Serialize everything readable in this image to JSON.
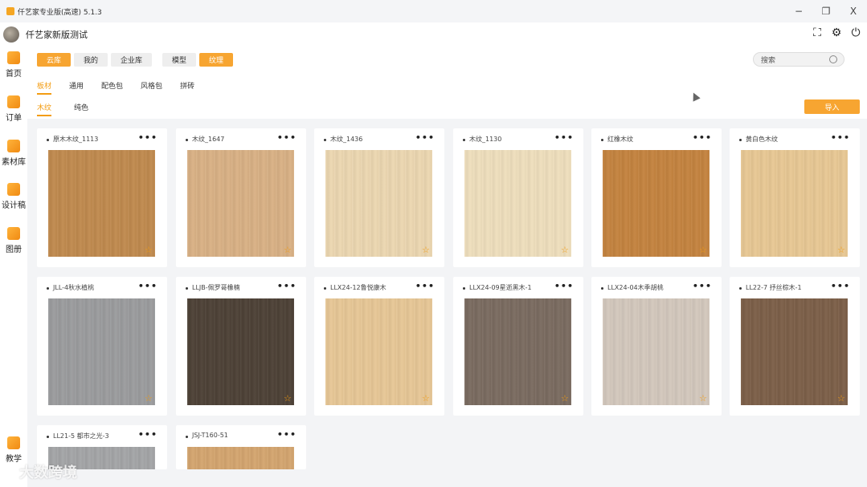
{
  "window": {
    "title": "仟艺家专业版(高速) 5.1.3",
    "min": "−",
    "max": "❐",
    "close": "X"
  },
  "header": {
    "user": "仟艺家新版测试"
  },
  "sidebar": [
    {
      "label": "首页",
      "icon": "home-icon"
    },
    {
      "label": "订单",
      "icon": "order-icon"
    },
    {
      "label": "素材库",
      "icon": "material-icon"
    },
    {
      "label": "设计稿",
      "icon": "design-icon"
    },
    {
      "label": "图册",
      "icon": "album-icon"
    },
    {
      "label": "教学",
      "icon": "teach-icon"
    }
  ],
  "tabs": {
    "cloud": "云库",
    "mine": "我的",
    "enterprise": "企业库",
    "model": "模型",
    "texture": "纹理"
  },
  "search": {
    "placeholder": "搜索"
  },
  "categories": [
    "板材",
    "通用",
    "配色包",
    "风格包",
    "拼砖"
  ],
  "subcategories": [
    "木纹",
    "纯色"
  ],
  "import_label": "导入",
  "materials": [
    {
      "name": "原木木纹_1113",
      "color": "#c08a4e"
    },
    {
      "name": "木纹_1647",
      "color": "#d9b185"
    },
    {
      "name": "木纹_1436",
      "color": "#ecd7b1"
    },
    {
      "name": "木纹_1130",
      "color": "#efdfbd"
    },
    {
      "name": "红橡木纹",
      "color": "#c4833f"
    },
    {
      "name": "黄白色木纹",
      "color": "#e8c894"
    },
    {
      "name": "JLL-4秋水植桃",
      "color": "#9b9c9e"
    },
    {
      "name": "LLJB-佩罗哥橡楠",
      "color": "#4d4136"
    },
    {
      "name": "LLX24-12鲁悦康木",
      "color": "#e7c796"
    },
    {
      "name": "LLX24-09星逝黑木-1",
      "color": "#7a6b60"
    },
    {
      "name": "LLX24-04木季胡桃",
      "color": "#d3c8bd"
    },
    {
      "name": "LL22-7 抒丝棕木-1",
      "color": "#7c5f48"
    },
    {
      "name": "LL21-5 都市之光-3",
      "color": "#a4a5a7"
    },
    {
      "name": "JSJ-T160-51",
      "color": "#d4a56f"
    }
  ],
  "watermark": "大数跨境"
}
